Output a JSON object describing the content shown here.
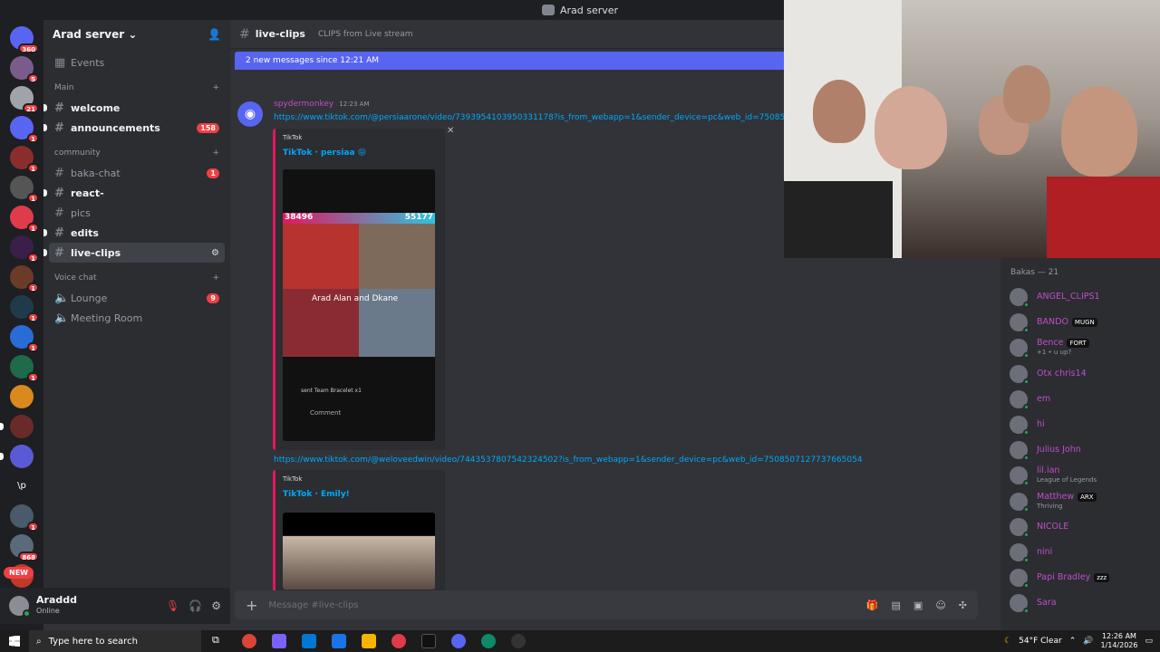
{
  "window": {
    "title": "Arad server"
  },
  "server": {
    "name": "Arad server",
    "events_label": "Events",
    "categories": [
      {
        "label": "Main",
        "channels": [
          {
            "name": "welcome",
            "unread": true
          },
          {
            "name": "announcements",
            "unread": true,
            "count": "158"
          }
        ]
      },
      {
        "label": "community",
        "channels": [
          {
            "name": "baka-chat",
            "unread": false,
            "count": "1"
          },
          {
            "name": "react-",
            "unread": true
          },
          {
            "name": "pics",
            "unread": false
          },
          {
            "name": "edits",
            "unread": true
          },
          {
            "name": "live-clips",
            "unread": true,
            "active": true
          }
        ]
      },
      {
        "label": "Voice chat",
        "channels": [
          {
            "name": "Lounge",
            "voice": true,
            "count": "9"
          },
          {
            "name": "Meeting Room",
            "voice": true
          }
        ]
      }
    ]
  },
  "server_rail": {
    "badges": [
      "360",
      "5",
      "21",
      "1",
      "1",
      "1",
      "1",
      "1",
      "1",
      "1",
      "1",
      "1",
      "1",
      "1",
      "1",
      "868",
      "NEW"
    ]
  },
  "user": {
    "name": "Araddd",
    "status": "Online"
  },
  "channel": {
    "name": "live-clips",
    "topic": "CLIPS from Live stream"
  },
  "banner": {
    "text": "2 new messages since 12:21 AM"
  },
  "message": {
    "author": "spydermonkey",
    "time": "12:23 AM",
    "links": [
      "https://www.tiktok.com/@persiaarone/video/7393954103950331178?is_from_webapp=1&sender_device=pc&web_id=75085",
      "https://www.tiktok.com/@weloveedwin/video/7443537807542324502?is_from_webapp=1&sender_device=pc&web_id=7508507127737665054"
    ],
    "embeds": [
      {
        "provider": "TikTok",
        "title": "TikTok · persiaa 😝",
        "thumb_text": {
          "score_left": "38496",
          "score_right": "55177",
          "caption": "Arad Alan and Dkane",
          "sent": "sent Team Bracelet x1",
          "comment": "Comment"
        }
      },
      {
        "provider": "TikTok",
        "title": "TikTok · Emily!"
      }
    ]
  },
  "composer": {
    "placeholder": "Message #live-clips"
  },
  "members": {
    "header": "Bakas — 21",
    "list": [
      {
        "name": "ANGEL_CLIPS1",
        "color": "#c04dc9"
      },
      {
        "name": "BANDO",
        "tag": "MUGN",
        "color": "#c04dc9"
      },
      {
        "name": "Bence",
        "tag": "FORT",
        "sub": "+1 • u up?",
        "color": "#c04dc9"
      },
      {
        "name": "Otx chris14",
        "color": "#c04dc9"
      },
      {
        "name": "em",
        "color": "#c04dc9"
      },
      {
        "name": "hi",
        "color": "#c04dc9"
      },
      {
        "name": "Julius John",
        "color": "#c04dc9"
      },
      {
        "name": "lil.ian",
        "sub": "League of Legends",
        "color": "#c04dc9"
      },
      {
        "name": "Matthew",
        "tag": "ARX",
        "sub": "Thriving",
        "color": "#c04dc9"
      },
      {
        "name": "NICOLE",
        "color": "#c04dc9"
      },
      {
        "name": "nini",
        "color": "#c04dc9"
      },
      {
        "name": "Papi Bradley",
        "tag": "zzz",
        "color": "#c04dc9"
      },
      {
        "name": "Sara",
        "color": "#c04dc9"
      }
    ]
  },
  "taskbar": {
    "search_placeholder": "Type here to search",
    "weather": "54°F  Clear",
    "time": "12:26 AM",
    "date": "1/14/2026"
  },
  "colors": {
    "accent": "#5865f2",
    "unread_badge": "#f23f43",
    "embed_bar": "#e3165f",
    "link": "#00a8fc"
  }
}
